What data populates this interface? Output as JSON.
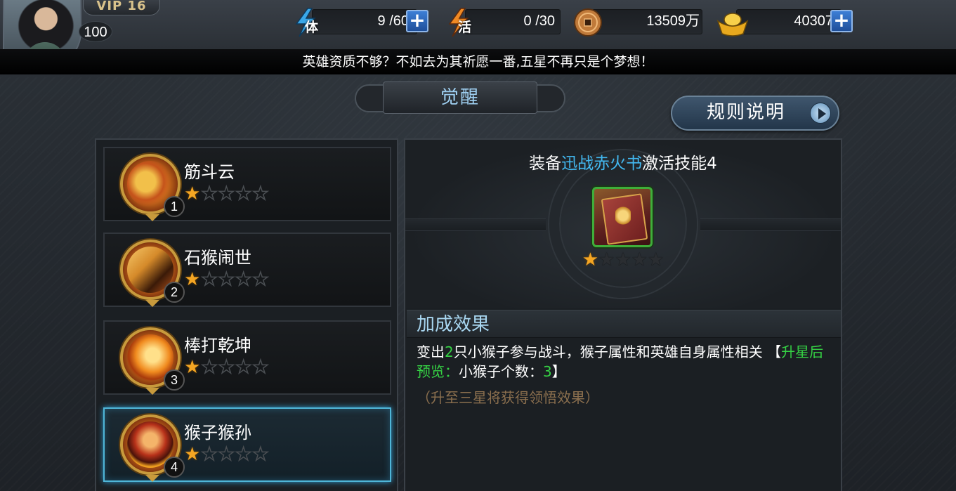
{
  "player": {
    "vip": "VIP 16",
    "level": "100"
  },
  "resources": {
    "stamina": {
      "icon_label": "体",
      "value": "9 /60"
    },
    "vitality": {
      "icon_label": "活",
      "value": "0 /30"
    },
    "coins": {
      "value": "13509万"
    },
    "gold": {
      "value": "40307"
    }
  },
  "notice": "英雄资质不够？不如去为其祈愿一番,五星不再只是个梦想！",
  "page_title": "觉醒",
  "rules_button": "规则说明",
  "skills": [
    {
      "name": "筋斗云",
      "index": "1",
      "stars": 1,
      "max_stars": 5
    },
    {
      "name": "石猴闹世",
      "index": "2",
      "stars": 1,
      "max_stars": 5
    },
    {
      "name": "棒打乾坤",
      "index": "3",
      "stars": 1,
      "max_stars": 5
    },
    {
      "name": "猴子猴孙",
      "index": "4",
      "stars": 1,
      "max_stars": 5
    }
  ],
  "selected_skill_index": 3,
  "equip": {
    "prefix": "装备",
    "item_name": "迅战赤火书",
    "suffix": "激活技能4",
    "stars": 1,
    "max_stars": 5
  },
  "effect": {
    "header": "加成效果",
    "desc_part1": "变出",
    "desc_num": "2",
    "desc_part2": "只小猴子参与战斗，猴子属性和英雄自身属性相关 【",
    "desc_preview_label": "升星后预览：",
    "desc_part3": "小猴子个数：",
    "desc_num2": "3",
    "desc_part4": "】",
    "note": "（升至三星将获得领悟效果）"
  },
  "colors": {
    "accent_blue": "#42b8f0",
    "green": "#35d244",
    "star_gold": "#f5a623",
    "selected_border": "#4fb6d8"
  }
}
